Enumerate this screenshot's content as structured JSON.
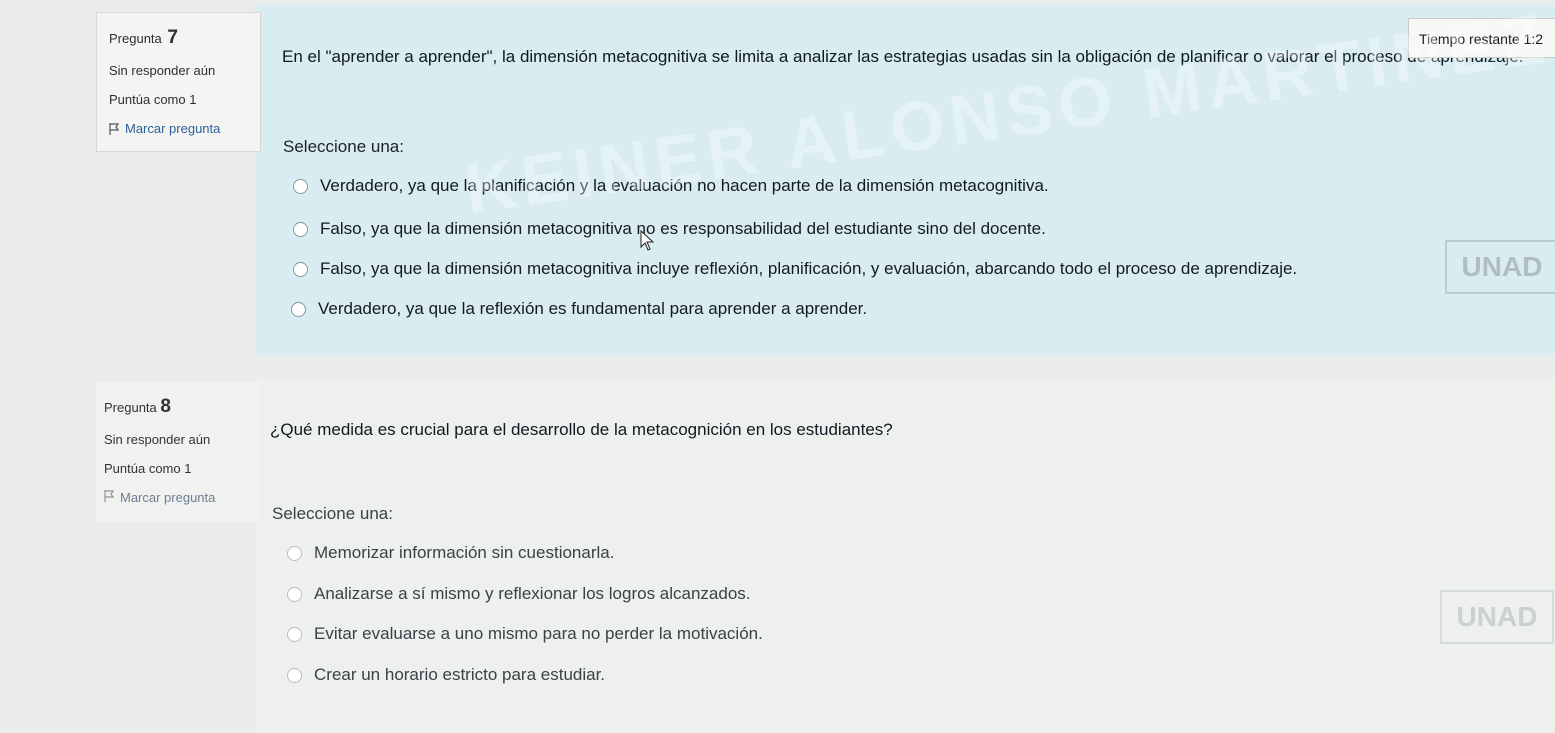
{
  "timer": {
    "label": "Tiempo restante 1:2"
  },
  "q7": {
    "label": "Pregunta",
    "number": "7",
    "status": "Sin responder aún",
    "score": "Puntúa como 1",
    "flag": "Marcar pregunta",
    "text": "En el \"aprender a aprender\", la dimensión metacognitiva se limita a analizar las estrategias usadas sin la obligación de planificar o valorar el proceso de aprendizaje.",
    "select": "Seleccione una:",
    "options": [
      "Verdadero, ya que la planificación y la evaluación no hacen parte de la dimensión metacognitiva.",
      "Falso, ya que la dimensión metacognitiva no es responsabilidad del estudiante sino del docente.",
      "Falso, ya que la dimensión metacognitiva incluye reflexión, planificación, y evaluación, abarcando todo el proceso de aprendizaje.",
      "Verdadero, ya que la reflexión es fundamental para aprender a aprender."
    ]
  },
  "q8": {
    "label": "Pregunta",
    "number": "8",
    "status": "Sin responder aún",
    "score": "Puntúa como 1",
    "flag": "Marcar pregunta",
    "text": "¿Qué medida es crucial para el desarrollo de la metacognición en los estudiantes?",
    "select": "Seleccione una:",
    "options": [
      "Memorizar información sin cuestionarla.",
      "Analizarse a sí mismo y reflexionar los logros alcanzados.",
      "Evitar evaluarse a uno mismo para no perder la motivación.",
      "Crear un horario estricto para estudiar."
    ]
  },
  "watermark": {
    "line1": "KEINER ALONSO MARTINEZ ALFONSO",
    "logo": "UNAD"
  }
}
